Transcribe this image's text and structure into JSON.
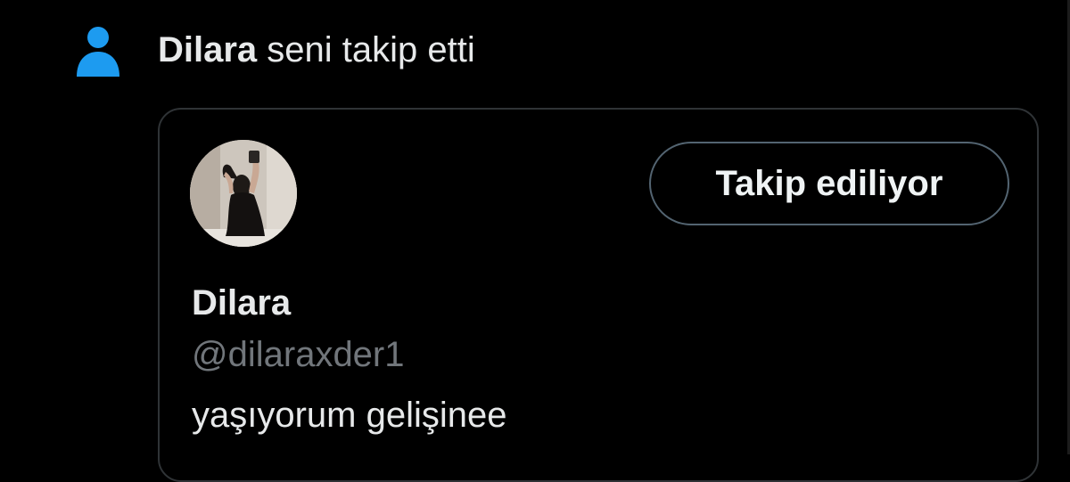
{
  "notification": {
    "icon": "person-icon",
    "icon_color": "#1d9bf0",
    "actor_name": "Dilara",
    "action_text": " seni takip etti"
  },
  "user_card": {
    "display_name": "Dilara",
    "handle": "@dilaraxder1",
    "bio": "yaşıyorum gelişinee",
    "follow_button_label": "Takip ediliyor"
  },
  "colors": {
    "background": "#000000",
    "primary_text": "#e7e9ea",
    "secondary_text": "#71767b",
    "card_border": "#2f3336",
    "button_border": "#536471",
    "accent": "#1d9bf0"
  }
}
